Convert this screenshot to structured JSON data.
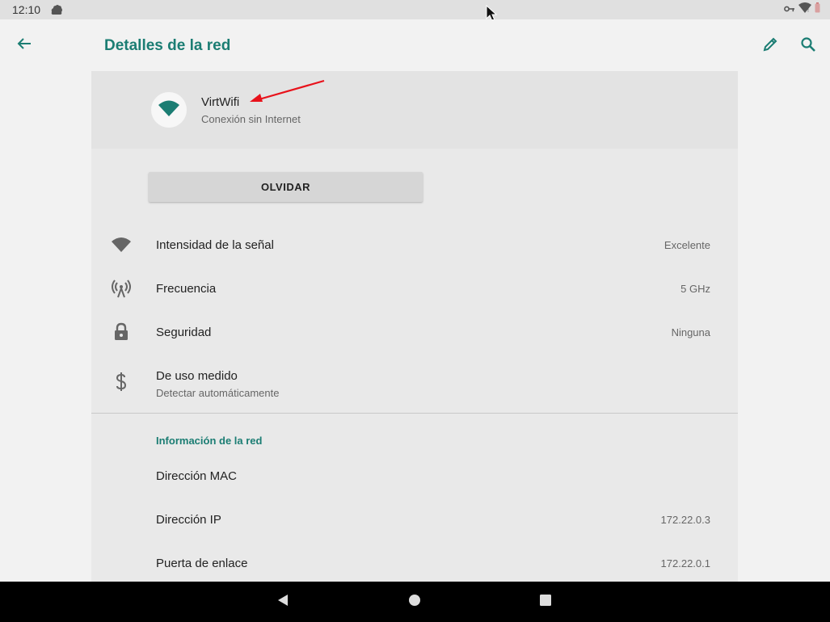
{
  "status_bar": {
    "time": "12:10",
    "left_icon": "android-notification-icon",
    "right_icons": [
      "vpn-key-icon",
      "wifi-icon",
      "battery-icon"
    ]
  },
  "app_bar": {
    "title": "Detalles de la red",
    "back_icon": "back-arrow-icon",
    "edit_icon": "pencil-icon",
    "search_icon": "search-icon"
  },
  "network": {
    "name": "VirtWifi",
    "status": "Conexión sin Internet"
  },
  "forget_button": {
    "label": "OLVIDAR"
  },
  "details": [
    {
      "icon": "wifi-signal-icon",
      "title": "Intensidad de la señal",
      "value": "Excelente"
    },
    {
      "icon": "antenna-icon",
      "title": "Frecuencia",
      "value": "5 GHz"
    },
    {
      "icon": "lock-icon",
      "title": "Seguridad",
      "value": "Ninguna"
    },
    {
      "icon": "dollar-icon",
      "title": "De uso medido",
      "subtitle": "Detectar automáticamente"
    }
  ],
  "network_info": {
    "section_title": "Información de la red",
    "rows": [
      {
        "title": "Dirección MAC",
        "value": ""
      },
      {
        "title": "Dirección IP",
        "value": "172.22.0.3"
      },
      {
        "title": "Puerta de enlace",
        "value": "172.22.0.1"
      }
    ]
  },
  "colors": {
    "accent": "#1b7d73",
    "annotation_arrow": "#e8121b"
  }
}
